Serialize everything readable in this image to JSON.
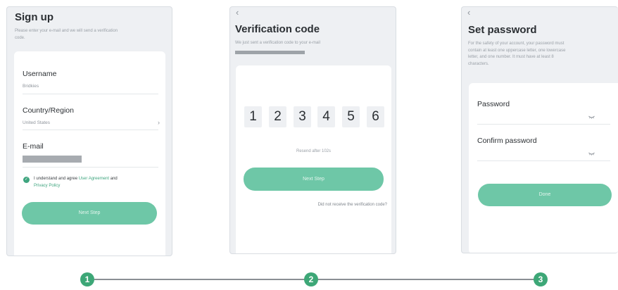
{
  "signup": {
    "title": "Sign up",
    "subtitle_line1": "Please enter your e-mail and we will send a verification",
    "subtitle_line2": "code.",
    "username_label": "Username",
    "username_value": "Bridkies",
    "country_label": "Country/Region",
    "country_value": "United States",
    "email_label": "E-mail",
    "agree_prefix": "I understand and agree ",
    "agree_link1": "User Agreement",
    "agree_mid": " and",
    "agree_link2": "Privacy Policy",
    "next_button": "Next Step"
  },
  "verification": {
    "back_glyph": "‹",
    "title": "Verification code",
    "subtitle": "We just sent a verification code to your e-mail",
    "digits": [
      "1",
      "2",
      "3",
      "4",
      "5",
      "6"
    ],
    "resend": "Resend after 102s",
    "next_button": "Next Step",
    "not_received": "Did not receive the verification code?"
  },
  "password": {
    "back_glyph": "‹",
    "title": "Set password",
    "desc_line1": "For the safety of your account, your password must",
    "desc_line2": "contain at least one uppercase letter, one lowercase",
    "desc_line3": "letter, and one number. It must have at least 8",
    "desc_line4": "characters.",
    "password_label": "Password",
    "confirm_label": "Confirm password",
    "done_button": "Done"
  },
  "steps": [
    "1",
    "2",
    "3"
  ],
  "colors": {
    "accent": "#6ec7a7",
    "accent_dark": "#3da777",
    "screen_bg": "#eef0f3",
    "card_bg": "#ffffff"
  },
  "icons": {
    "back": "chevron-left-icon",
    "select": "chevron-right-icon",
    "checkbox": "check-circle-icon",
    "password_visibility": "eye-closed-icon"
  }
}
